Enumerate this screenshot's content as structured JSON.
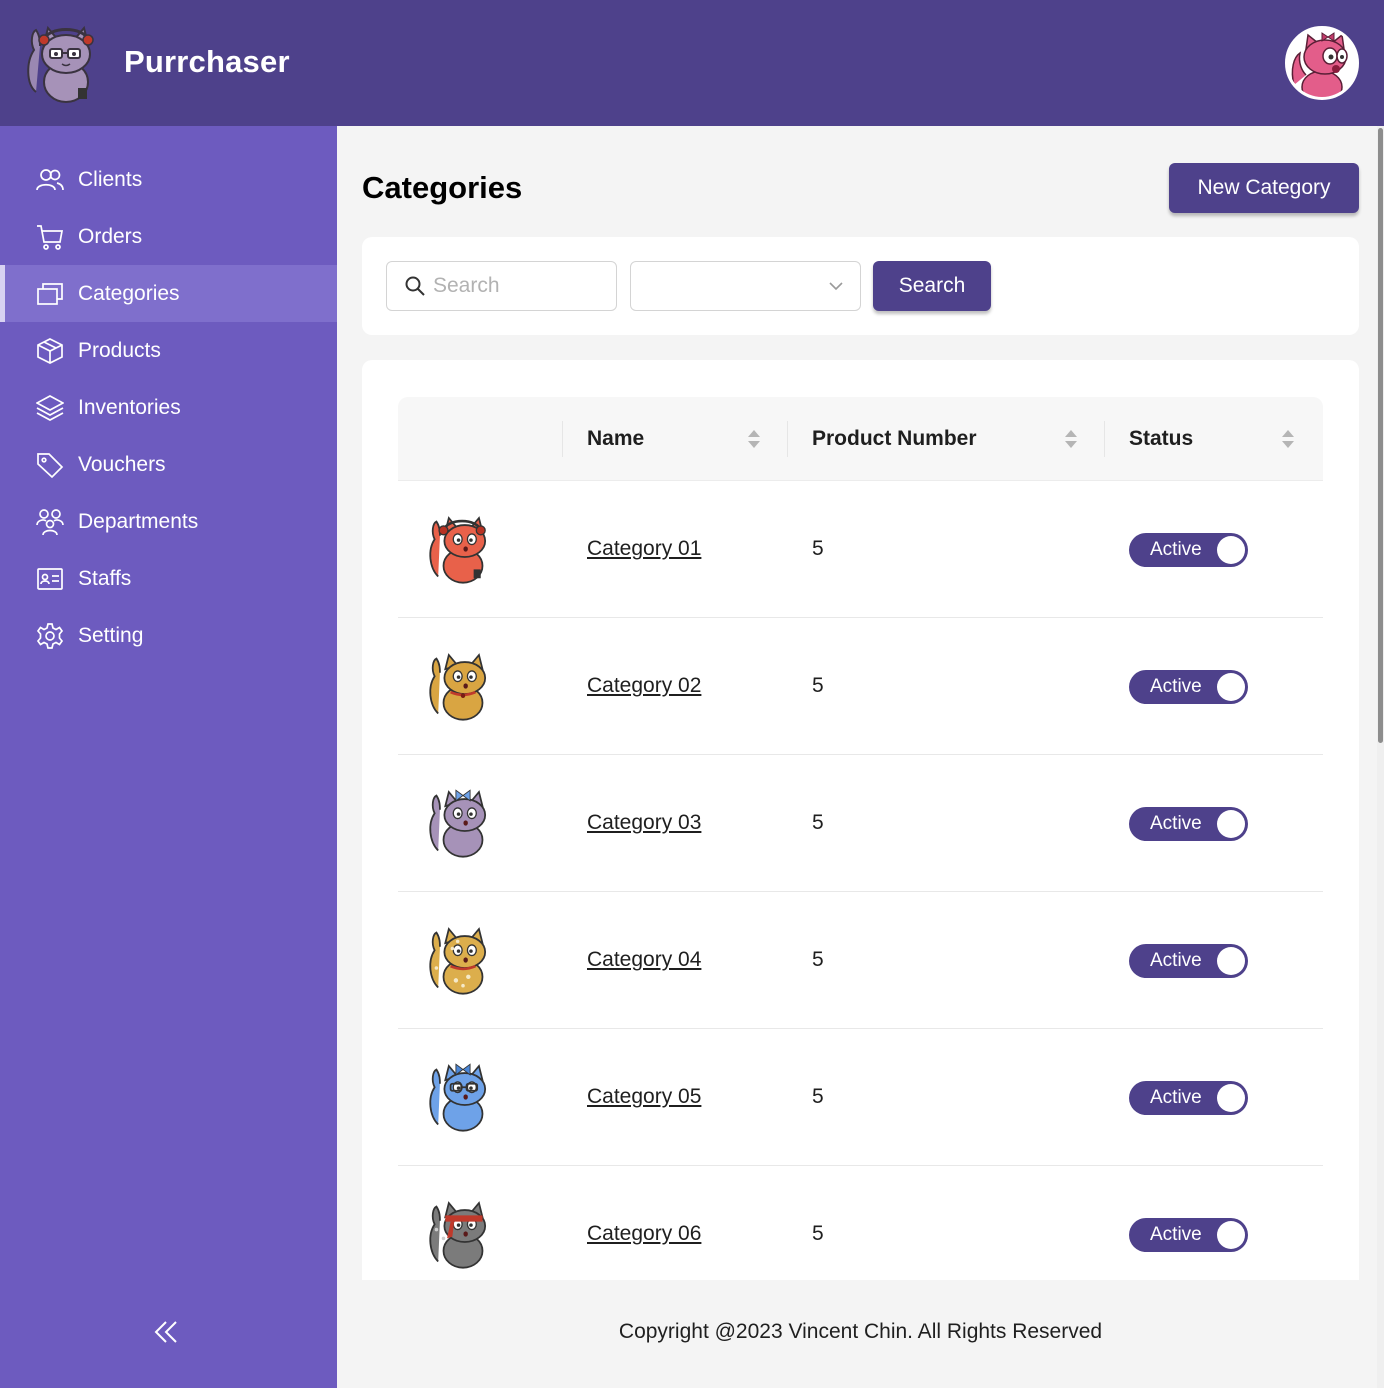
{
  "app": {
    "name": "Purrchaser"
  },
  "sidebar": {
    "items": [
      {
        "label": "Clients",
        "icon": "users-icon",
        "active": false
      },
      {
        "label": "Orders",
        "icon": "cart-icon",
        "active": false
      },
      {
        "label": "Categories",
        "icon": "windows-icon",
        "active": true
      },
      {
        "label": "Products",
        "icon": "box-icon",
        "active": false
      },
      {
        "label": "Inventories",
        "icon": "layers-icon",
        "active": false
      },
      {
        "label": "Vouchers",
        "icon": "tag-icon",
        "active": false
      },
      {
        "label": "Departments",
        "icon": "team-icon",
        "active": false
      },
      {
        "label": "Staffs",
        "icon": "id-card-icon",
        "active": false
      },
      {
        "label": "Setting",
        "icon": "gear-icon",
        "active": false
      }
    ],
    "collapse_icon": "double-chevron-left-icon"
  },
  "main": {
    "title": "Categories",
    "new_button": "New Category",
    "filters": {
      "search_placeholder": "Search",
      "search_value": "",
      "select_value": "",
      "search_button": "Search"
    },
    "table": {
      "columns": [
        "",
        "Name",
        "Product Number",
        "Status"
      ],
      "rows": [
        {
          "name": "Category 01",
          "product_number": "5",
          "status": "Active",
          "cat_color": "#e8614a",
          "accessory": "headphones"
        },
        {
          "name": "Category 02",
          "product_number": "5",
          "status": "Active",
          "cat_color": "#d9a542",
          "accessory": "collar"
        },
        {
          "name": "Category 03",
          "product_number": "5",
          "status": "Active",
          "cat_color": "#a692b8",
          "accessory": "bow"
        },
        {
          "name": "Category 04",
          "product_number": "5",
          "status": "Active",
          "cat_color": "#dcae4c",
          "accessory": "spots"
        },
        {
          "name": "Category 05",
          "product_number": "5",
          "status": "Active",
          "cat_color": "#6ea2e8",
          "accessory": "glasses"
        },
        {
          "name": "Category 06",
          "product_number": "5",
          "status": "Active",
          "cat_color": "#7b7b7b",
          "accessory": "headband"
        }
      ]
    }
  },
  "footer": {
    "text": "Copyright @2023 Vincent Chin. All Rights Reserved"
  },
  "colors": {
    "header": "#4e418b",
    "sidebar": "#6d5bbf",
    "accent": "#4e418b"
  }
}
